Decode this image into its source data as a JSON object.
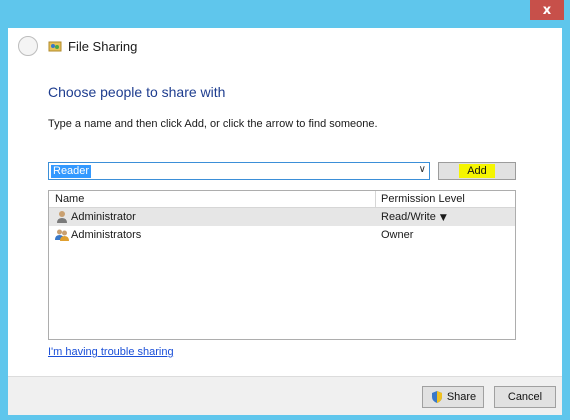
{
  "window": {
    "title": "File Sharing",
    "close_label": "x"
  },
  "main": {
    "heading": "Choose people to share with",
    "instruction": "Type a name and then click Add, or click the arrow to find someone.",
    "input_value": "Reader",
    "add_label": "Add"
  },
  "list": {
    "headers": {
      "name": "Name",
      "permission": "Permission Level"
    },
    "rows": [
      {
        "name": "Administrator",
        "permission": "Read/Write",
        "icon": "user-icon",
        "selected": true
      },
      {
        "name": "Administrators",
        "permission": "Owner",
        "icon": "users-group-icon",
        "selected": false
      }
    ]
  },
  "links": {
    "trouble": "I'm having trouble sharing"
  },
  "footer": {
    "share_label": "Share",
    "cancel_label": "Cancel"
  },
  "colors": {
    "frame": "#5fc6ec",
    "heading": "#1e3d8f",
    "highlight": "#f5f500",
    "selection": "#3399ff",
    "close": "#c7504a"
  }
}
